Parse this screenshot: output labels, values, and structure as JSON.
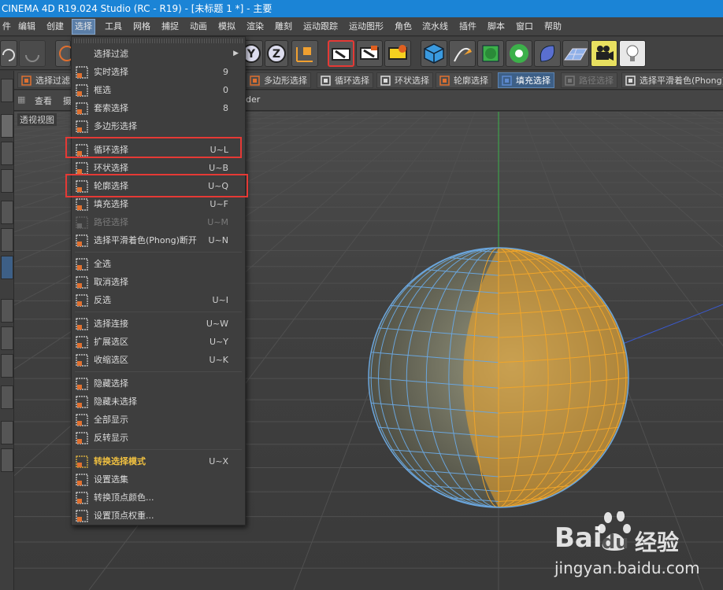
{
  "window": {
    "title": "CINEMA 4D R19.024 Studio (RC - R19) - [未标题 1 *] - 主要"
  },
  "menubar": [
    {
      "label": "件"
    },
    {
      "label": "编辑"
    },
    {
      "label": "创建"
    },
    {
      "label": "选择",
      "active": true
    },
    {
      "label": "工具"
    },
    {
      "label": "网格"
    },
    {
      "label": "捕捉"
    },
    {
      "label": "动画"
    },
    {
      "label": "模拟"
    },
    {
      "label": "渲染"
    },
    {
      "label": "雕刻"
    },
    {
      "label": "运动跟踪"
    },
    {
      "label": "运动图形"
    },
    {
      "label": "角色"
    },
    {
      "label": "流水线"
    },
    {
      "label": "插件"
    },
    {
      "label": "脚本"
    },
    {
      "label": "窗口"
    },
    {
      "label": "帮助"
    }
  ],
  "selection_toolbar": [
    {
      "label": "选择过滤",
      "icon": "cursor-icon"
    },
    {
      "label": "多边形选择",
      "icon": "polygon-select-icon"
    },
    {
      "label": "循环选择",
      "icon": "loop-select-icon"
    },
    {
      "label": "环状选择",
      "icon": "ring-select-icon"
    },
    {
      "label": "轮廓选择",
      "icon": "outline-select-icon"
    },
    {
      "label": "填充选择",
      "icon": "fill-select-icon",
      "active": true
    },
    {
      "label": "路径选择",
      "icon": "path-select-icon",
      "disabled": true
    },
    {
      "label": "选择平滑着色(Phong)",
      "icon": "phong-break-icon"
    }
  ],
  "viewport_header": {
    "view": "查看",
    "camera_frag": "摄",
    "display_frag": "der"
  },
  "viewport": {
    "label": "透视视图"
  },
  "select_menu": {
    "items": [
      {
        "label": "选择过滤",
        "shortcut": "",
        "submenu": true,
        "icon": ""
      },
      {
        "label": "实时选择",
        "shortcut": "9",
        "icon": "live-select-icon"
      },
      {
        "label": "框选",
        "shortcut": "0",
        "icon": "rectangle-select-icon"
      },
      {
        "label": "套索选择",
        "shortcut": "8",
        "icon": "lasso-select-icon"
      },
      {
        "label": "多边形选择",
        "shortcut": "",
        "icon": "polygon-select-icon"
      },
      {
        "separator": true
      },
      {
        "label": "循环选择",
        "shortcut": "U~L",
        "icon": "loop-select-icon",
        "highlight": true
      },
      {
        "label": "环状选择",
        "shortcut": "U~B",
        "icon": "ring-select-icon"
      },
      {
        "label": "轮廓选择",
        "shortcut": "U~Q",
        "icon": "outline-select-icon",
        "highlight": true
      },
      {
        "label": "填充选择",
        "shortcut": "U~F",
        "icon": "fill-select-icon"
      },
      {
        "label": "路径选择",
        "shortcut": "U~M",
        "icon": "path-select-icon",
        "disabled": true
      },
      {
        "label": "选择平滑着色(Phong)断开",
        "shortcut": "U~N",
        "icon": "phong-break-icon"
      },
      {
        "separator": true
      },
      {
        "label": "全选",
        "shortcut": "",
        "icon": "select-all-icon"
      },
      {
        "label": "取消选择",
        "shortcut": "",
        "icon": "deselect-icon"
      },
      {
        "label": "反选",
        "shortcut": "U~I",
        "icon": "invert-select-icon"
      },
      {
        "separator": true
      },
      {
        "label": "选择连接",
        "shortcut": "U~W",
        "icon": "select-connected-icon"
      },
      {
        "label": "扩展选区",
        "shortcut": "U~Y",
        "icon": "grow-select-icon"
      },
      {
        "label": "收缩选区",
        "shortcut": "U~K",
        "icon": "shrink-select-icon"
      },
      {
        "separator": true
      },
      {
        "label": "隐藏选择",
        "shortcut": "",
        "icon": "hide-selected-icon"
      },
      {
        "label": "隐藏未选择",
        "shortcut": "",
        "icon": "hide-unselected-icon"
      },
      {
        "label": "全部显示",
        "shortcut": "",
        "icon": "unhide-all-icon"
      },
      {
        "label": "反转显示",
        "shortcut": "",
        "icon": "invert-visibility-icon"
      },
      {
        "separator": true
      },
      {
        "label": "转换选择模式",
        "shortcut": "U~X",
        "icon": "convert-selection-icon",
        "bold": true
      },
      {
        "label": "设置选集",
        "shortcut": "",
        "icon": "set-selection-icon"
      },
      {
        "label": "转换顶点颜色...",
        "shortcut": "",
        "icon": "vertex-color-icon"
      },
      {
        "label": "设置顶点权重...",
        "shortcut": "",
        "icon": "vertex-weight-icon"
      }
    ]
  },
  "watermark": {
    "brand": "Bai",
    "brand_cn": "经验",
    "du": "du",
    "url": "jingyan.baidu.com"
  },
  "colors": {
    "accent": "#1b84d6",
    "highlight_box": "#e53935",
    "sphere_selected": "#f0a52a",
    "sphere_unselected": "#6aa5dc"
  }
}
